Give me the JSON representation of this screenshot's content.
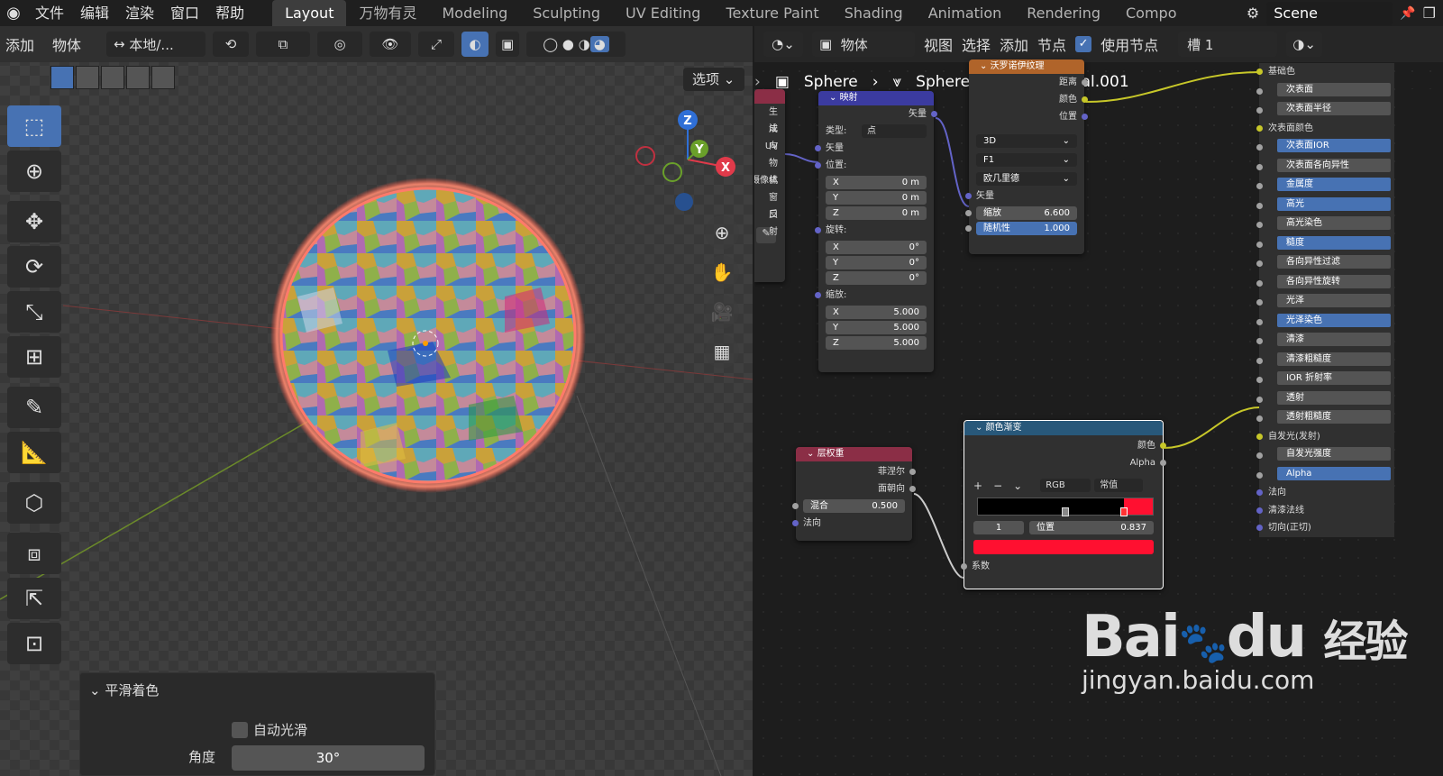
{
  "topbar": {
    "menus": [
      "文件",
      "编辑",
      "渲染",
      "窗口",
      "帮助"
    ],
    "workspaces": [
      "Layout",
      "万物有灵",
      "Modeling",
      "Sculpting",
      "UV Editing",
      "Texture Paint",
      "Shading",
      "Animation",
      "Rendering",
      "Compo"
    ],
    "active_workspace": "Layout",
    "scene": "Scene"
  },
  "viewport": {
    "header": {
      "add": "添加",
      "object": "物体",
      "orientation": "本地/..."
    },
    "options": "选项",
    "gizmo": {
      "x": "X",
      "y": "Y",
      "z": "Z"
    },
    "smooth_panel": {
      "title": "平滑着色",
      "auto_smooth": "自动光滑",
      "angle_label": "角度",
      "angle_value": "30°"
    }
  },
  "node_editor": {
    "header": {
      "mode": "物体",
      "view": "视图",
      "select": "选择",
      "add": "添加",
      "node": "节点",
      "use_nodes": "使用节点",
      "slot": "槽 1"
    },
    "breadcrumb": [
      "Sphere",
      "Sphere",
      "Material.001"
    ],
    "texcoord": {
      "outputs": [
        "生成",
        "法向",
        "UV",
        "物体",
        "摄像机",
        "窗口",
        "反射"
      ]
    },
    "mapping": {
      "title": "映射",
      "out": "矢量",
      "type_label": "类型:",
      "type_value": "点",
      "vector": "矢量",
      "location": "位置:",
      "rotation": "旋转:",
      "scale": "缩放:",
      "loc": [
        [
          "X",
          "0 m"
        ],
        [
          "Y",
          "0 m"
        ],
        [
          "Z",
          "0 m"
        ]
      ],
      "rot": [
        [
          "X",
          "0°"
        ],
        [
          "Y",
          "0°"
        ],
        [
          "Z",
          "0°"
        ]
      ],
      "scl": [
        [
          "X",
          "5.000"
        ],
        [
          "Y",
          "5.000"
        ],
        [
          "Z",
          "5.000"
        ]
      ]
    },
    "voronoi": {
      "title": "沃罗诺伊纹理",
      "out_dist": "距离",
      "out_color": "颜色",
      "out_pos": "位置",
      "dim": "3D",
      "feature": "F1",
      "metric": "欧几里德",
      "vector": "矢量",
      "scale_label": "缩放",
      "scale_value": "6.600",
      "rand_label": "随机性",
      "rand_value": "1.000"
    },
    "layerweight": {
      "title": "层权重",
      "fresnel": "菲涅尔",
      "facing": "面朝向",
      "blend_label": "混合",
      "blend_value": "0.500",
      "normal": "法向"
    },
    "colorramp": {
      "title": "颜色渐变",
      "color": "颜色",
      "alpha": "Alpha",
      "mode": "RGB",
      "interp": "常值",
      "index": "1",
      "pos_label": "位置",
      "pos_value": "0.837",
      "fac": "系数",
      "stop_color": "#ff1030"
    },
    "principled": {
      "rows": [
        [
          "基础色",
          "label"
        ],
        [
          "次表面",
          "field"
        ],
        [
          "次表面半径",
          "field"
        ],
        [
          "次表面颜色",
          "label"
        ],
        [
          "次表面IOR",
          "fieldb"
        ],
        [
          "次表面各向异性",
          "field"
        ],
        [
          "金属度",
          "fieldb"
        ],
        [
          "高光",
          "fieldb"
        ],
        [
          "高光染色",
          "field"
        ],
        [
          "糙度",
          "fieldb"
        ],
        [
          "各向异性过滤",
          "field"
        ],
        [
          "各向异性旋转",
          "field"
        ],
        [
          "光泽",
          "field"
        ],
        [
          "光泽染色",
          "fieldb"
        ],
        [
          "清漆",
          "field"
        ],
        [
          "清漆粗糙度",
          "field"
        ],
        [
          "IOR 折射率",
          "field"
        ],
        [
          "透射",
          "field"
        ],
        [
          "透射粗糙度",
          "field"
        ],
        [
          "自发光(发射)",
          "label"
        ],
        [
          "自发光强度",
          "field"
        ],
        [
          "Alpha",
          "fieldb"
        ],
        [
          "法向",
          "label"
        ],
        [
          "清漆法线",
          "label"
        ],
        [
          "切向(正切)",
          "label"
        ]
      ]
    }
  },
  "watermark": {
    "brand": "Bai",
    "brand2": "du",
    "site": "经验",
    "url": "jingyan.baidu.com"
  }
}
